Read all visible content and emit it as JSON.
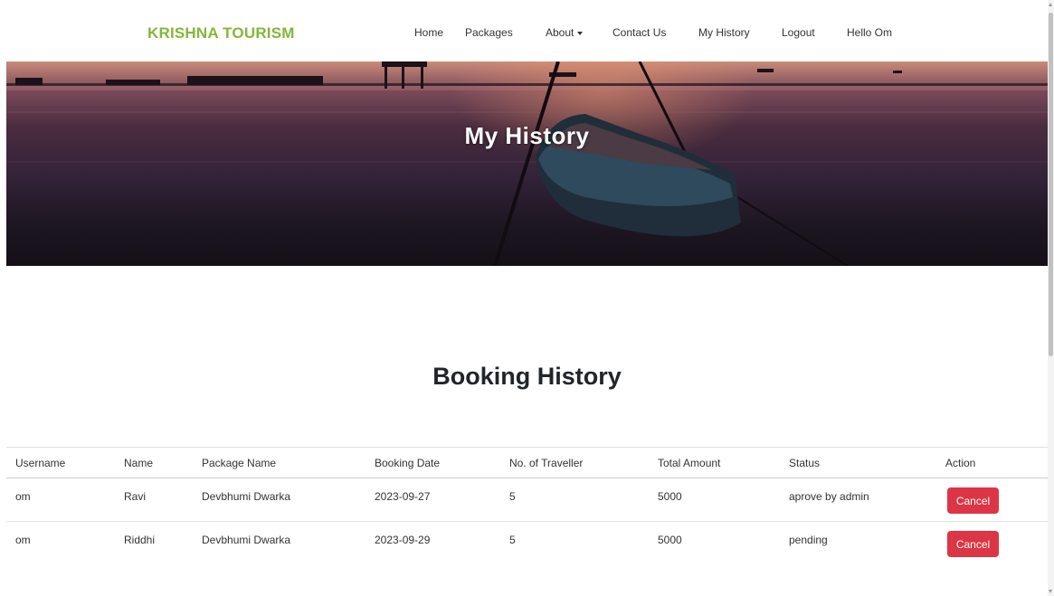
{
  "navbar": {
    "brand": "KRISHNA TOURISM",
    "links": {
      "home": "Home",
      "packages": "Packages",
      "about": "About",
      "contact": "Contact Us",
      "history": "My History",
      "logout": "Logout",
      "greeting": "Hello Om"
    }
  },
  "hero": {
    "title": "My History"
  },
  "section": {
    "title": "Booking History"
  },
  "table": {
    "headers": {
      "username": "Username",
      "name": "Name",
      "package": "Package Name",
      "date": "Booking Date",
      "travellers": "No. of Traveller",
      "amount": "Total Amount",
      "status": "Status",
      "action": "Action"
    },
    "rows": [
      {
        "username": "om",
        "name": "Ravi",
        "package": "Devbhumi Dwarka",
        "date": "2023-09-27",
        "travellers": "5",
        "amount": "5000",
        "status": "aprove by admin",
        "action": "Cancel"
      },
      {
        "username": "om",
        "name": "Riddhi",
        "package": "Devbhumi Dwarka",
        "date": "2023-09-29",
        "travellers": "5",
        "amount": "5000",
        "status": "pending",
        "action": "Cancel"
      }
    ]
  },
  "colors": {
    "brand": "#84b63a",
    "danger": "#dc3545"
  }
}
